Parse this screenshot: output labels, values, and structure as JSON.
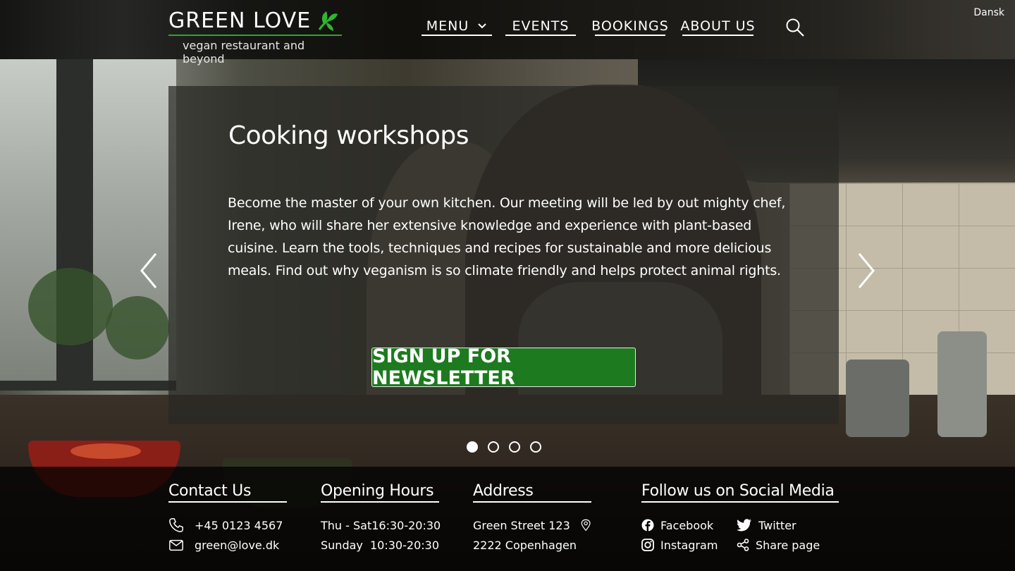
{
  "header": {
    "brand": "GREEN LOVE",
    "tagline": "vegan restaurant and beyond",
    "nav": [
      {
        "label": "MENU"
      },
      {
        "label": "EVENTS"
      },
      {
        "label": "BOOKINGS"
      },
      {
        "label": "ABOUT US"
      }
    ],
    "language": "Dansk"
  },
  "hero": {
    "title": "Cooking workshops",
    "text": "Become the master of your own kitchen.   Our meeting will be led by out mighty chef, Irene, who will share her extensive knowledge and experience with plant-based cuisine.  Learn the tools, techniques and recipes for sustainable and more delicious meals.  Find out why veganism is so climate friendly and helps protect animal rights.",
    "cta_label": "SIGN UP FOR NEWSLETTER",
    "slides_total": 4,
    "slide_active": 1
  },
  "footer": {
    "contact": {
      "title": "Contact  Us",
      "phone": "+45 0123 4567",
      "email": "green@love.dk"
    },
    "hours": {
      "title": "Opening Hours",
      "rows": [
        {
          "day": "Thu - Sat",
          "time": "16:30-20:30"
        },
        {
          "day": "Sunday",
          "time": "10:30-20:30"
        }
      ]
    },
    "address": {
      "title": "Address",
      "line1": "Green Street 123",
      "line2": "2222 Copenhagen"
    },
    "social": {
      "title": "Follow us on Social Media",
      "links": [
        {
          "label": "Facebook",
          "icon": "facebook-icon"
        },
        {
          "label": "Twitter",
          "icon": "twitter-icon"
        },
        {
          "label": "Instagram",
          "icon": "instagram-icon"
        },
        {
          "label": "Share page",
          "icon": "share-icon"
        }
      ]
    }
  },
  "colors": {
    "accent_green": "#1d7a1f",
    "logo_line": "#2aa82a"
  }
}
